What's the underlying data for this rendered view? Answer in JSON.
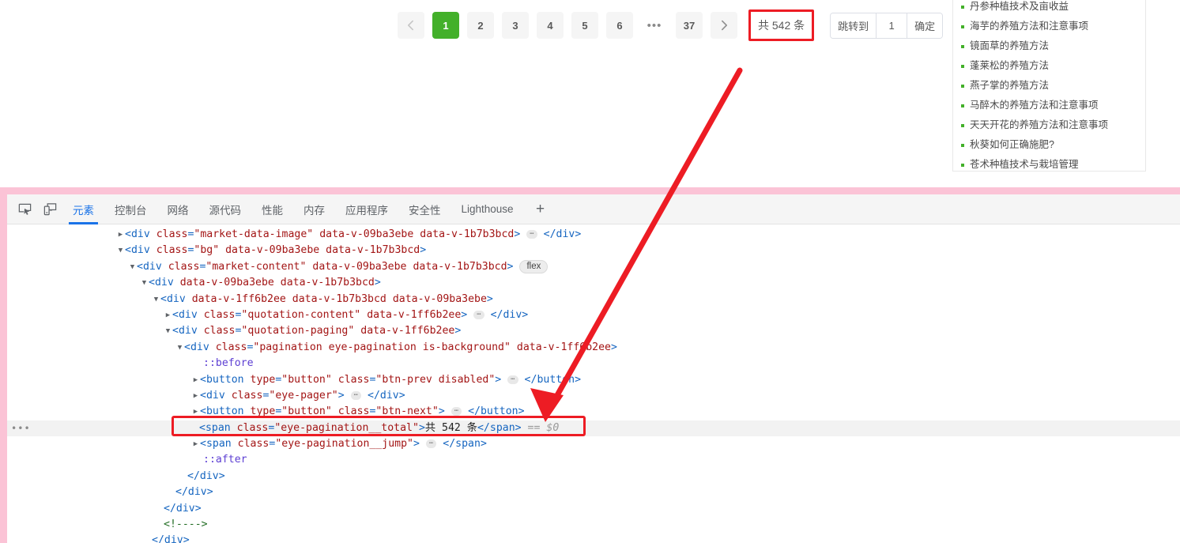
{
  "pagination": {
    "prev_icon": "chevron-left-icon",
    "next_icon": "chevron-right-icon",
    "pages": [
      "1",
      "2",
      "3",
      "4",
      "5",
      "6"
    ],
    "ellipsis": "•••",
    "last_page": "37",
    "active_page": "1",
    "total_label": "共 542 条",
    "jump_label": "跳转到",
    "jump_value": "1",
    "confirm_label": "确定",
    "active_color": "#43b02a",
    "highlight_color": "#ed1c24"
  },
  "sidebar": {
    "items": [
      {
        "label": "丹参种植技术及亩收益"
      },
      {
        "label": "海芋的养殖方法和注意事项"
      },
      {
        "label": "镜面草的养殖方法"
      },
      {
        "label": "蓬莱松的养殖方法"
      },
      {
        "label": "燕子掌的养殖方法"
      },
      {
        "label": "马醉木的养殖方法和注意事项"
      },
      {
        "label": "天天开花的养殖方法和注意事项"
      },
      {
        "label": "秋葵如何正确施肥?"
      },
      {
        "label": "苍术种植技术与栽培管理"
      }
    ]
  },
  "devtools": {
    "inspect_icon": "inspect-element-icon",
    "device_icon": "device-toolbar-icon",
    "add_tab_label": "+",
    "tabs": [
      {
        "label": "元素",
        "active": true
      },
      {
        "label": "控制台",
        "active": false
      },
      {
        "label": "网络",
        "active": false
      },
      {
        "label": "源代码",
        "active": false
      },
      {
        "label": "性能",
        "active": false
      },
      {
        "label": "内存",
        "active": false
      },
      {
        "label": "应用程序",
        "active": false
      },
      {
        "label": "安全性",
        "active": false
      },
      {
        "label": "Lighthouse",
        "active": false
      }
    ],
    "active_tab_color": "#1a73e8",
    "gutter_more": "•••",
    "dom": {
      "l1_div": "div",
      "l1_class_attr": "class",
      "l1_class_val": "\"market-data-image\"",
      "l1_a1": "data-v-09ba3ebe",
      "l1_a2": "data-v-1b7b3bcd",
      "l2_class_val": "\"bg\"",
      "l3_class_val": "\"market-content\"",
      "l3_badge": "flex",
      "l4_a1": "data-v-09ba3ebe",
      "l4_a2": "data-v-1b7b3bcd",
      "l5_a1": "data-v-1ff6b2ee",
      "l5_a2": "data-v-1b7b3bcd",
      "l5_a3": "data-v-09ba3ebe",
      "l6_class_val": "\"quotation-content\"",
      "l6_a1": "data-v-1ff6b2ee",
      "l7_class_val": "\"quotation-paging\"",
      "l8_class_val": "\"pagination eye-pagination is-background\"",
      "pseudo_before": "::before",
      "pseudo_after": "::after",
      "btn_tag": "button",
      "type_attr": "type",
      "type_val": "\"button\"",
      "btn_prev_class": "\"btn-prev disabled\"",
      "eye_pager_class": "\"eye-pager\"",
      "btn_next_class": "\"btn-next\"",
      "span_tag": "span",
      "total_class": "\"eye-pagination__total\"",
      "total_text": "共 542 条",
      "eq_marker": "==",
      "dollar_zero": "$0",
      "jump_class": "\"eye-pagination__jump\"",
      "close_div": "</div>",
      "comment": "<!---->"
    }
  },
  "annotation": {
    "arrow_color": "#ed1c24",
    "box_color": "#ed1c24"
  }
}
